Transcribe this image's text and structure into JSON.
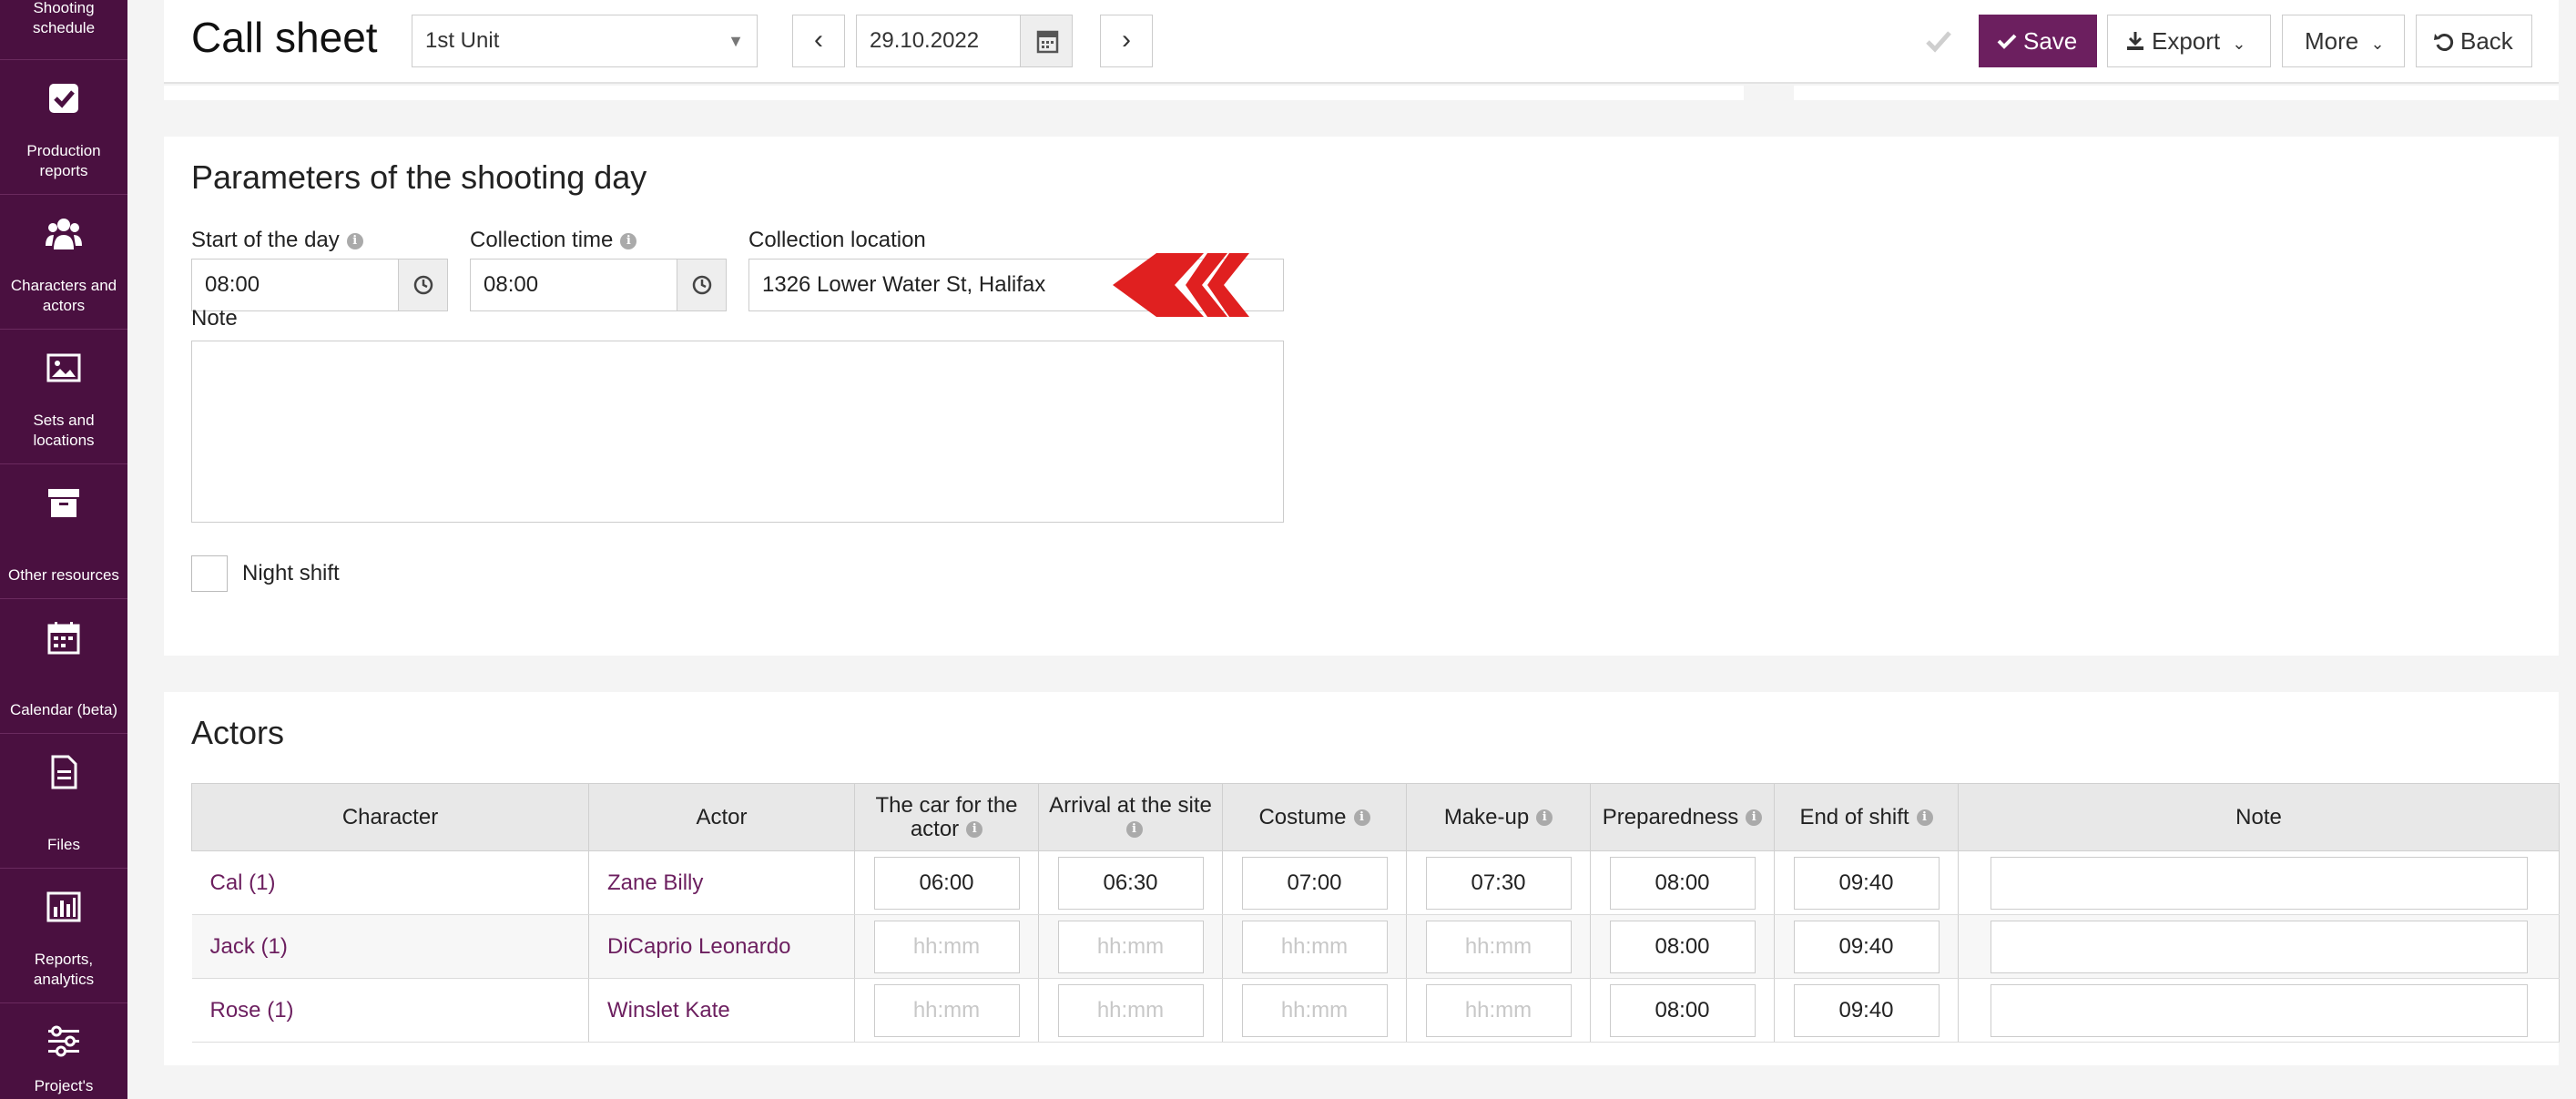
{
  "sidebar": {
    "items": [
      {
        "label": "Shooting schedule",
        "icon": "calendar-grid-icon"
      },
      {
        "label": "Production reports",
        "icon": "checkbox-icon"
      },
      {
        "label": "Characters and actors",
        "icon": "people-icon"
      },
      {
        "label": "Sets and locations",
        "icon": "image-icon"
      },
      {
        "label": "Other resources",
        "icon": "archive-box-icon"
      },
      {
        "label": "Calendar (beta)",
        "icon": "calendar-icon"
      },
      {
        "label": "Files",
        "icon": "file-icon"
      },
      {
        "label": "Reports, analytics",
        "icon": "bar-chart-icon"
      },
      {
        "label": "Project's",
        "icon": "sliders-icon"
      }
    ]
  },
  "header": {
    "title": "Call sheet",
    "unit_select": "1st Unit",
    "prev_label": "‹",
    "next_label": "›",
    "date": "29.10.2022",
    "save_label": "Save",
    "export_label": "Export",
    "more_label": "More",
    "back_label": "Back"
  },
  "params": {
    "title": "Parameters of the shooting day",
    "start_label": "Start of the day",
    "start_value": "08:00",
    "collection_time_label": "Collection time",
    "collection_time_value": "08:00",
    "collection_location_label": "Collection location",
    "collection_location_value": "1326 Lower Water St, Halifax",
    "note_label": "Note",
    "night_shift_label": "Night shift"
  },
  "actors": {
    "title": "Actors",
    "columns": [
      "Character",
      "Actor",
      "The car for the actor",
      "Arrival at the site",
      "Costume",
      "Make-up",
      "Preparedness",
      "End of shift",
      "Note"
    ],
    "time_placeholder": "hh:mm",
    "rows": [
      {
        "character": "Cal (1)",
        "actor": "Zane Billy",
        "car": "06:00",
        "arrival": "06:30",
        "costume": "07:00",
        "makeup": "07:30",
        "preparedness": "08:00",
        "end_of_shift": "09:40"
      },
      {
        "character": "Jack (1)",
        "actor": "DiCaprio Leonardo",
        "car": "",
        "arrival": "",
        "costume": "",
        "makeup": "",
        "preparedness": "08:00",
        "end_of_shift": "09:40"
      },
      {
        "character": "Rose (1)",
        "actor": "Winslet Kate",
        "car": "",
        "arrival": "",
        "costume": "",
        "makeup": "",
        "preparedness": "08:00",
        "end_of_shift": "09:40"
      }
    ]
  },
  "colors": {
    "sidebar": "#4a1040",
    "accent": "#6c1f5f",
    "arrow": "#e02020"
  }
}
